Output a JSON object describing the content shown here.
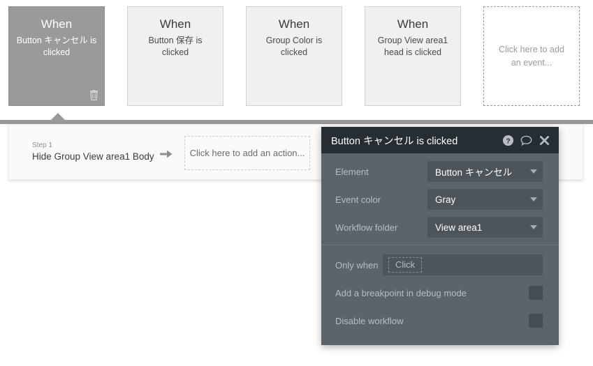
{
  "events": [
    {
      "when_label": "When",
      "description": "Button キャンセル is clicked",
      "selected": true,
      "delete_icon": "trash-icon"
    },
    {
      "when_label": "When",
      "description": "Button 保存 is clicked",
      "selected": false
    },
    {
      "when_label": "When",
      "description": "Group Color is clicked",
      "selected": false
    },
    {
      "when_label": "When",
      "description": "Group View area1 head is clicked",
      "selected": false
    }
  ],
  "add_event_placeholder": "Click here to add an event...",
  "workflow": {
    "step_label": "Step 1",
    "step_text": "Hide Group View area1 Body",
    "arrow_icon": "arrow-right-icon",
    "add_action_placeholder": "Click here to add an action..."
  },
  "property_panel": {
    "title": "Button キャンセル is clicked",
    "header_icons": [
      {
        "name": "help-icon",
        "glyph": "?"
      },
      {
        "name": "comment-icon",
        "glyph": "speech-bubble"
      },
      {
        "name": "close-icon",
        "glyph": "✖"
      }
    ],
    "fields": [
      {
        "label": "Element",
        "value": "Button キャンセル"
      },
      {
        "label": "Event color",
        "value": "Gray"
      },
      {
        "label": "Workflow folder",
        "value": "View area1"
      }
    ],
    "only_when": {
      "label": "Only when",
      "chip": "Click"
    },
    "checkboxes": [
      {
        "label": "Add a breakpoint in debug mode",
        "checked": false
      },
      {
        "label": "Disable workflow",
        "checked": false
      }
    ]
  },
  "colors": {
    "selected_card": "#9a9a9a",
    "card_bg": "#f0f0f0",
    "panel_header": "#272e33",
    "panel_body": "#5c6369",
    "field_bg": "#4d545a",
    "accent_bar": "#999999"
  }
}
